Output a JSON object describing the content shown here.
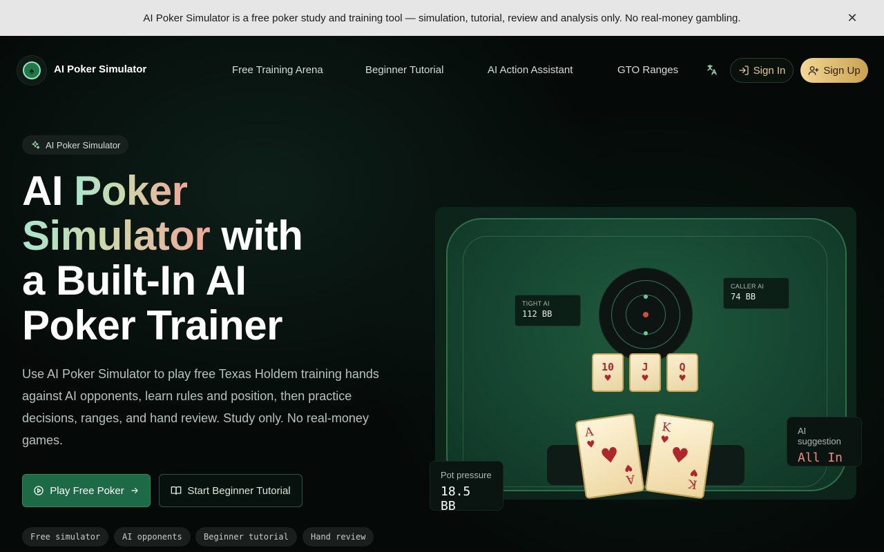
{
  "banner": {
    "text": "AI Poker Simulator is a free poker study and training tool — simulation, tutorial, review and analysis only. No real-money gambling.",
    "close_glyph": "✕"
  },
  "nav": {
    "brand": "AI Poker Simulator",
    "links": [
      "Free Training Arena",
      "Beginner Tutorial",
      "AI Action Assistant",
      "GTO Ranges"
    ],
    "sign_in": "Sign In",
    "sign_up": "Sign Up"
  },
  "hero": {
    "pill": "AI Poker Simulator",
    "title_line1_a": "AI ",
    "title_line1_b": "Poker",
    "title_line2_a": "Simulator",
    "title_line2_b": " with",
    "title_line3": "a Built-In AI",
    "title_line4": "Poker Trainer",
    "description": "Use AI Poker Simulator to play free Texas Holdem training hands against AI opponents, learn rules and position, then practice decisions, ranges, and hand review. Study only. No real-money games.",
    "play_button": "Play Free Poker",
    "tutorial_button": "Start Beginner Tutorial",
    "tags": [
      "Free simulator",
      "AI opponents",
      "Beginner tutorial",
      "Hand review"
    ]
  },
  "table": {
    "seat_left": {
      "name": "TIGHT AI",
      "stack": "112 BB"
    },
    "seat_right": {
      "name": "CALLER AI",
      "stack": "74 BB"
    },
    "board": [
      {
        "rank": "10",
        "suit": "♥"
      },
      {
        "rank": "J",
        "suit": "♥"
      },
      {
        "rank": "Q",
        "suit": "♥"
      }
    ],
    "hole": [
      {
        "rank": "A",
        "suit": "♥"
      },
      {
        "rank": "K",
        "suit": "♥"
      }
    ],
    "pot_label": "Pot pressure",
    "pot_value": "18.5 BB",
    "suggestion_label": "AI suggestion",
    "suggestion_value": "All In"
  },
  "colors": {
    "accent_green": "#1c6a46",
    "gold": "#e6c98a",
    "suggestion_red": "#f08a7a"
  }
}
